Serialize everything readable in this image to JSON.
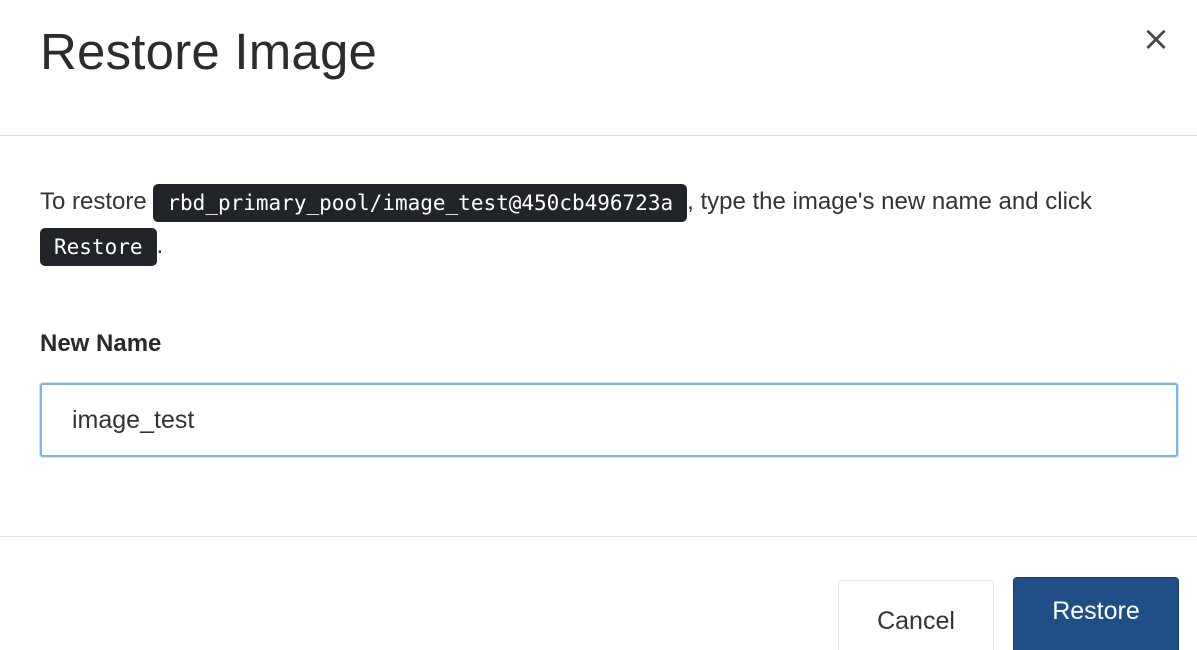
{
  "dialog": {
    "title": "Restore Image",
    "close_icon": "close-icon",
    "close_symbol": "×"
  },
  "body": {
    "instruction_prefix": "To restore ",
    "snapshot_name": "rbd_primary_pool/image_test@450cb496723a",
    "instruction_middle": ", type the image's new name and click ",
    "restore_keyword": "Restore",
    "instruction_suffix": "."
  },
  "form": {
    "new_name_label": "New Name",
    "new_name_value": "image_test"
  },
  "footer": {
    "cancel_label": "Cancel",
    "restore_label": "Restore"
  },
  "colors": {
    "primary_button": "#1f4f86",
    "code_background": "#212529",
    "input_focus_border": "#7fb2e5"
  }
}
